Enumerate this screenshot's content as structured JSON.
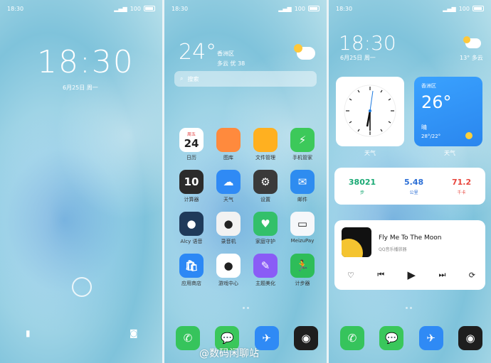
{
  "status": {
    "time": "18:30",
    "battery": "100"
  },
  "lock": {
    "time": "18:30",
    "date": "6月25日 周一"
  },
  "home": {
    "weather": {
      "temp": "24°",
      "location": "香洲区",
      "detail": "多云 优 38"
    },
    "search_placeholder": "搜索",
    "apps": [
      {
        "label": "日历",
        "name": "calendar",
        "icon_text": "24",
        "top_text": "周五",
        "color": "#ffffff"
      },
      {
        "label": "图库",
        "name": "gallery",
        "icon_text": "",
        "color": "#ff8a3d"
      },
      {
        "label": "文件管理",
        "name": "files",
        "icon_text": "",
        "color": "#ffb020"
      },
      {
        "label": "手机管家",
        "name": "phone-manager",
        "icon_text": "⚡",
        "color": "#3cc95a"
      },
      {
        "label": "计算器",
        "name": "calculator",
        "icon_text": "10",
        "color": "#2b2b2b"
      },
      {
        "label": "天气",
        "name": "weather",
        "icon_text": "☁",
        "color": "#2f8af5"
      },
      {
        "label": "设置",
        "name": "settings",
        "icon_text": "⚙",
        "color": "#3a3a3a"
      },
      {
        "label": "邮件",
        "name": "mail",
        "icon_text": "✉",
        "color": "#2e8cf0"
      },
      {
        "label": "Alcy 语音",
        "name": "alcy",
        "icon_text": "●",
        "color": "#1f3a5a"
      },
      {
        "label": "录音机",
        "name": "recorder",
        "icon_text": "●",
        "color": "#f2f2f2"
      },
      {
        "label": "家庭守护",
        "name": "family-guard",
        "icon_text": "♥",
        "color": "#33c06a"
      },
      {
        "label": "MeizuPay",
        "name": "meizupay",
        "icon_text": "▭",
        "color": "#f5f7fa"
      },
      {
        "label": "应用商店",
        "name": "app-store",
        "icon_text": "🛍",
        "color": "#2c88f5"
      },
      {
        "label": "游戏中心",
        "name": "game-center",
        "icon_text": "●",
        "color": "#ffffff"
      },
      {
        "label": "主题美化",
        "name": "themes",
        "icon_text": "✎",
        "color": "#8a5cf6"
      },
      {
        "label": "计步器",
        "name": "pedometer",
        "icon_text": "🏃",
        "color": "#2ebd59"
      }
    ],
    "dock": [
      {
        "name": "phone",
        "icon_text": "✆",
        "color": "#36c45c"
      },
      {
        "name": "messages",
        "icon_text": "💬",
        "color": "#3ac75b"
      },
      {
        "name": "browser",
        "icon_text": "✈",
        "color": "#2f8af5"
      },
      {
        "name": "camera",
        "icon_text": "◉",
        "color": "#1e1e1e"
      }
    ]
  },
  "widgets": {
    "time": "18:30",
    "date": "6月25日 周一",
    "top_weather": "13° 多云",
    "clock_label": "天气",
    "weather_card": {
      "location": "香洲区",
      "temp": "26°",
      "condition": "晴",
      "range": "28°/22°",
      "label": "天气"
    },
    "stats": [
      {
        "value": "38021",
        "unit": "步",
        "color": "#19a974"
      },
      {
        "value": "5.48",
        "unit": "公里",
        "color": "#2c6fd6"
      },
      {
        "value": "71.2",
        "unit": "千卡",
        "color": "#e8453c"
      }
    ],
    "music": {
      "title": "Fly Me To The Moon",
      "source": "QQ音乐播放器"
    }
  },
  "watermark": "@数码闲聊站"
}
